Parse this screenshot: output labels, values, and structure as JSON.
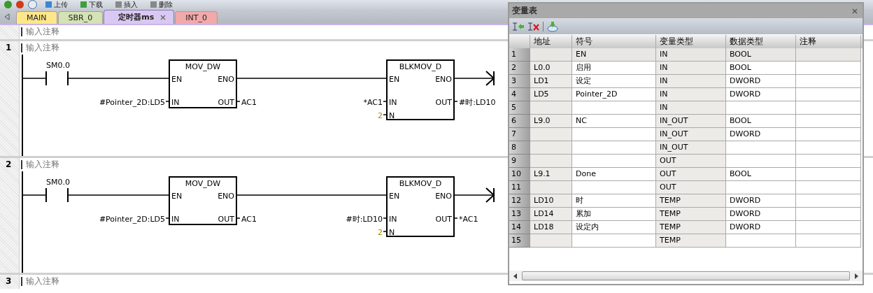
{
  "toolbar": [
    {
      "label": "上传"
    },
    {
      "label": "下载"
    },
    {
      "label": "插入"
    },
    {
      "label": "删除"
    }
  ],
  "tabs": [
    {
      "label": "MAIN",
      "selected": false,
      "color": "#fde78a"
    },
    {
      "label": "SBR_0",
      "selected": false,
      "color": "#d4e2b4"
    },
    {
      "label": "定时器ms",
      "selected": true,
      "color": "#d9c9f2"
    },
    {
      "label": "INT_0",
      "selected": false,
      "color": "#f2a9a9"
    }
  ],
  "networks": [
    {
      "comment": "输入注释"
    },
    {
      "number": "1",
      "comment": "输入注释",
      "contact": "SM0.0",
      "blocks": [
        {
          "title": "MOV_DW",
          "en": "EN",
          "eno": "ENO",
          "in": "IN",
          "out": "OUT",
          "in_operand": "#Pointer_2D:LD5",
          "out_operand": "AC1"
        },
        {
          "title": "BLKMOV_D",
          "en": "EN",
          "eno": "ENO",
          "in": "IN",
          "out": "OUT",
          "n": "N",
          "in_operand": "*AC1",
          "out_operand": "#时:LD10",
          "n_operand": "2"
        }
      ]
    },
    {
      "number": "2",
      "comment": "输入注释",
      "contact": "SM0.0",
      "blocks": [
        {
          "title": "MOV_DW",
          "en": "EN",
          "eno": "ENO",
          "in": "IN",
          "out": "OUT",
          "in_operand": "#Pointer_2D:LD5",
          "out_operand": "AC1"
        },
        {
          "title": "BLKMOV_D",
          "en": "EN",
          "eno": "ENO",
          "in": "IN",
          "out": "OUT",
          "n": "N",
          "in_operand": "#时:LD10",
          "out_operand": "*AC1",
          "n_operand": "2"
        }
      ]
    },
    {
      "number": "3",
      "comment": "输入注释"
    }
  ],
  "var_table": {
    "title": "变量表",
    "columns": [
      "地址",
      "符号",
      "变量类型",
      "数据类型",
      "注释"
    ],
    "rows": [
      {
        "number": "1",
        "address": "",
        "symbol": "EN",
        "var_type": "IN",
        "data_type": "BOOL",
        "readonly": true
      },
      {
        "number": "2",
        "address": "L0.0",
        "symbol": "启用",
        "var_type": "IN",
        "data_type": "BOOL",
        "readonly": false
      },
      {
        "number": "3",
        "address": "LD1",
        "symbol": "设定",
        "var_type": "IN",
        "data_type": "DWORD",
        "readonly": false
      },
      {
        "number": "4",
        "address": "LD5",
        "symbol": "Pointer_2D",
        "var_type": "IN",
        "data_type": "DWORD",
        "readonly": false
      },
      {
        "number": "5",
        "address": "",
        "symbol": "",
        "var_type": "IN",
        "data_type": "",
        "readonly": false
      },
      {
        "number": "6",
        "address": "L9.0",
        "symbol": "NC",
        "var_type": "IN_OUT",
        "data_type": "BOOL",
        "readonly": false
      },
      {
        "number": "7",
        "address": "",
        "symbol": "",
        "var_type": "IN_OUT",
        "data_type": "DWORD",
        "readonly": false
      },
      {
        "number": "8",
        "address": "",
        "symbol": "",
        "var_type": "IN_OUT",
        "data_type": "",
        "readonly": false
      },
      {
        "number": "9",
        "address": "",
        "symbol": "",
        "var_type": "OUT",
        "data_type": "",
        "readonly": false
      },
      {
        "number": "10",
        "address": "L9.1",
        "symbol": "Done",
        "var_type": "OUT",
        "data_type": "BOOL",
        "readonly": false
      },
      {
        "number": "11",
        "address": "",
        "symbol": "",
        "var_type": "OUT",
        "data_type": "",
        "readonly": false
      },
      {
        "number": "12",
        "address": "LD10",
        "symbol": "时",
        "var_type": "TEMP",
        "data_type": "DWORD",
        "readonly": false
      },
      {
        "number": "13",
        "address": "LD14",
        "symbol": "累加",
        "var_type": "TEMP",
        "data_type": "DWORD",
        "readonly": false
      },
      {
        "number": "14",
        "address": "LD18",
        "symbol": "设定内",
        "var_type": "TEMP",
        "data_type": "DWORD",
        "readonly": false
      },
      {
        "number": "15",
        "address": "",
        "symbol": "",
        "var_type": "TEMP",
        "data_type": "",
        "readonly": false
      }
    ]
  }
}
